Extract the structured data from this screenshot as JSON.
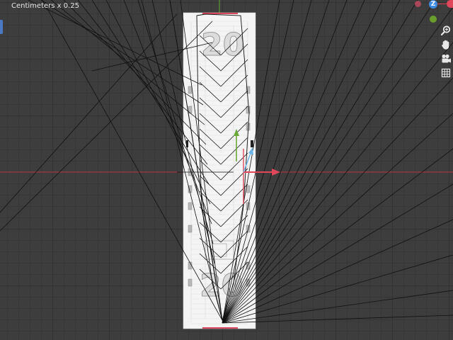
{
  "viewport": {
    "units_label": "Centimeters x 0.25"
  },
  "gizmo": {
    "z_label": "Z",
    "x_color": "#e0475a",
    "y_color": "#6a9e2c",
    "z_color": "#3d8be0"
  },
  "nav_icons": [
    "zoom-icon",
    "hand-icon",
    "camera-icon",
    "grid-icon"
  ],
  "colors": {
    "background": "#3d3d3d",
    "x_axis": "#dc3c4e",
    "y_axis": "#63a83a",
    "z_axis": "#4b86d2",
    "reference_image": "#f0f0f0"
  }
}
